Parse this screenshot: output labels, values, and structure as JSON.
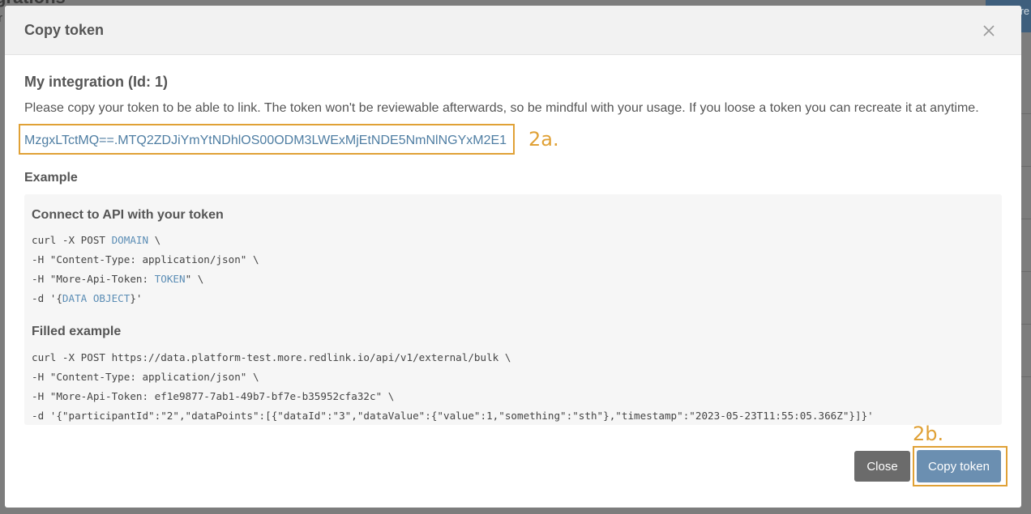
{
  "background": {
    "page_title_fragment": "grations",
    "subtitle_fragment": "r",
    "button_fragment": "+ Cre"
  },
  "modal": {
    "title": "Copy token",
    "close_icon": "close-icon",
    "integration_name": "My integration (Id: 1)",
    "description": "Please copy your token to be able to link. The token won't be reviewable afterwards, so be mindful with your usage. If you loose a token you can recreate it at anytime.",
    "token": "MzgxLTctMQ==.MTQ2ZDJiYmYtNDhlOS00ODM3LWExMjEtNDE5NmNlNGYxM2E1",
    "example_heading": "Example",
    "connect": {
      "title": "Connect to API with your token",
      "line1_prefix": "curl -X POST ",
      "line1_placeholder": "DOMAIN",
      "line1_suffix": " \\",
      "line2": "-H \"Content-Type: application/json\" \\",
      "line3_prefix": "-H \"More-Api-Token: ",
      "line3_placeholder": "TOKEN",
      "line3_suffix": "\" \\",
      "line4_prefix": "-d '{",
      "line4_placeholder": "DATA OBJECT",
      "line4_suffix": "}'"
    },
    "filled": {
      "title": "Filled example",
      "lines": [
        "curl -X POST https://data.platform-test.more.redlink.io/api/v1/external/bulk \\",
        "-H \"Content-Type: application/json\" \\",
        "-H \"More-Api-Token: ef1e9877-7ab1-49b7-bf7e-b35952cfa32c\" \\",
        "-d '{\"participantId\":\"2\",\"dataPoints\":[{\"dataId\":\"3\",\"dataValue\":{\"value\":1,\"something\":\"sth\"},\"timestamp\":\"2023-05-23T11:55:05.366Z\"}]}'"
      ]
    },
    "buttons": {
      "close": "Close",
      "copy": "Copy token"
    }
  },
  "annotations": {
    "token_callout": "2a.",
    "copy_callout": "2b."
  },
  "colors": {
    "highlight": "#e0a136",
    "token_text": "#4f7ea3",
    "primary_button": "#6b8fb1",
    "secondary_button": "#6b6b6b"
  }
}
